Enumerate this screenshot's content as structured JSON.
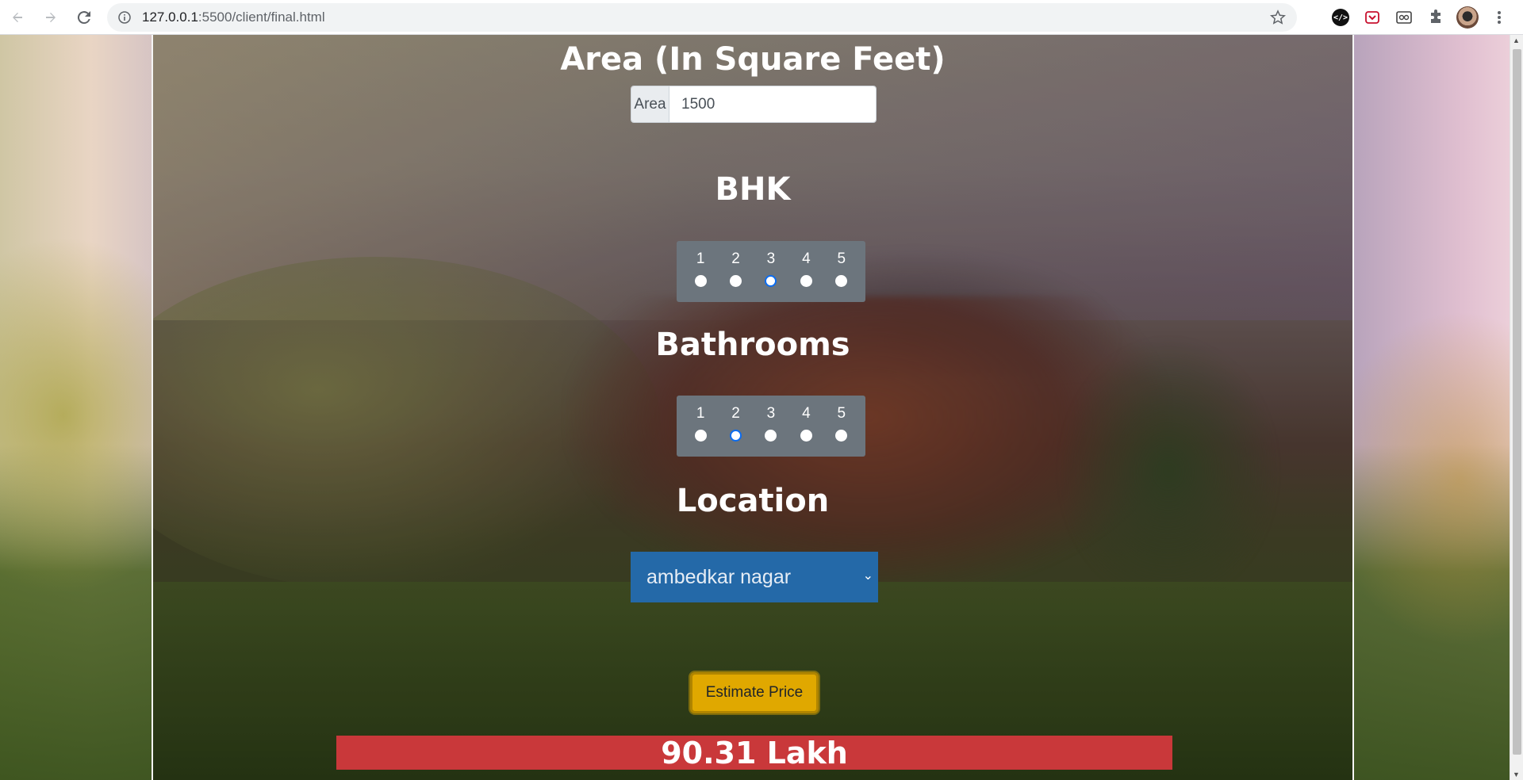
{
  "browser": {
    "url_host": "127.0.0.1",
    "url_rest": ":5500/client/final.html"
  },
  "form": {
    "area": {
      "heading": "Area (In Square Feet)",
      "prefix": "Area",
      "value": "1500"
    },
    "bhk": {
      "heading": "BHK",
      "options": [
        "1",
        "2",
        "3",
        "4",
        "5"
      ],
      "selected": "3"
    },
    "bathrooms": {
      "heading": "Bathrooms",
      "options": [
        "1",
        "2",
        "3",
        "4",
        "5"
      ],
      "selected": "2"
    },
    "location": {
      "heading": "Location",
      "selected": "ambedkar nagar"
    },
    "estimate_button": "Estimate Price",
    "result": "90.31 Lakh"
  },
  "colors": {
    "switch_bg": "#6c757d",
    "select_bg": "#2469a8",
    "button_bg": "#e0a800",
    "result_bg": "#c9383a"
  }
}
